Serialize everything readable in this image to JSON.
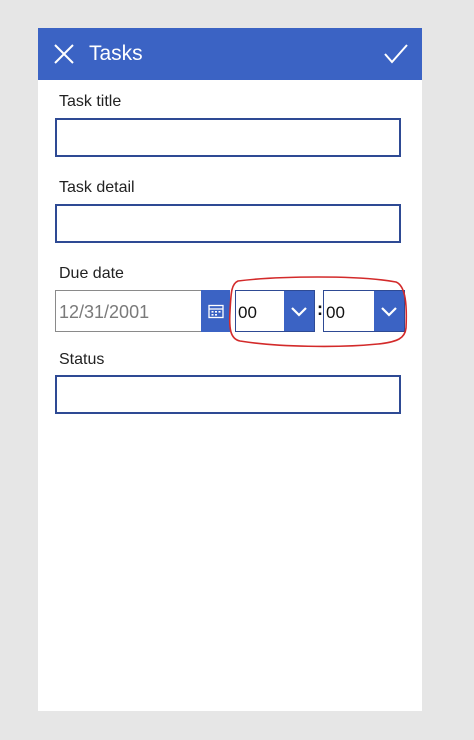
{
  "header": {
    "title": "Tasks",
    "close_icon": "close-icon",
    "confirm_icon": "checkmark-icon"
  },
  "form": {
    "task_title": {
      "label": "Task title",
      "value": ""
    },
    "task_detail": {
      "label": "Task detail",
      "value": ""
    },
    "due_date": {
      "label": "Due date",
      "date_value": "12/31/2001",
      "calendar_icon": "calendar-icon",
      "hour": "00",
      "separator": ":",
      "minute": "00",
      "dropdown_icon": "chevron-down-icon"
    },
    "status": {
      "label": "Status",
      "value": ""
    }
  },
  "colors": {
    "accent": "#3b63c4",
    "border": "#2e4a94",
    "annotation": "#d32a2a"
  }
}
